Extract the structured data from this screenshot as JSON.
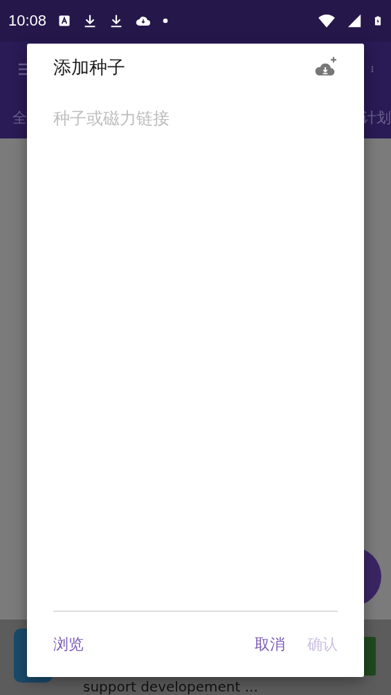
{
  "status_bar": {
    "time": "10:08"
  },
  "background": {
    "tab_left": "全",
    "tab_right": "计划",
    "banner_text": "support developement ..."
  },
  "dialog": {
    "title": "添加种子",
    "field": {
      "placeholder": "种子或磁力链接"
    },
    "buttons": [
      {
        "label": "浏览",
        "disabled": false,
        "kind": "left"
      },
      {
        "label": "取消",
        "disabled": false,
        "kind": "right"
      },
      {
        "label": "确认",
        "disabled": true,
        "kind": "right"
      }
    ]
  }
}
